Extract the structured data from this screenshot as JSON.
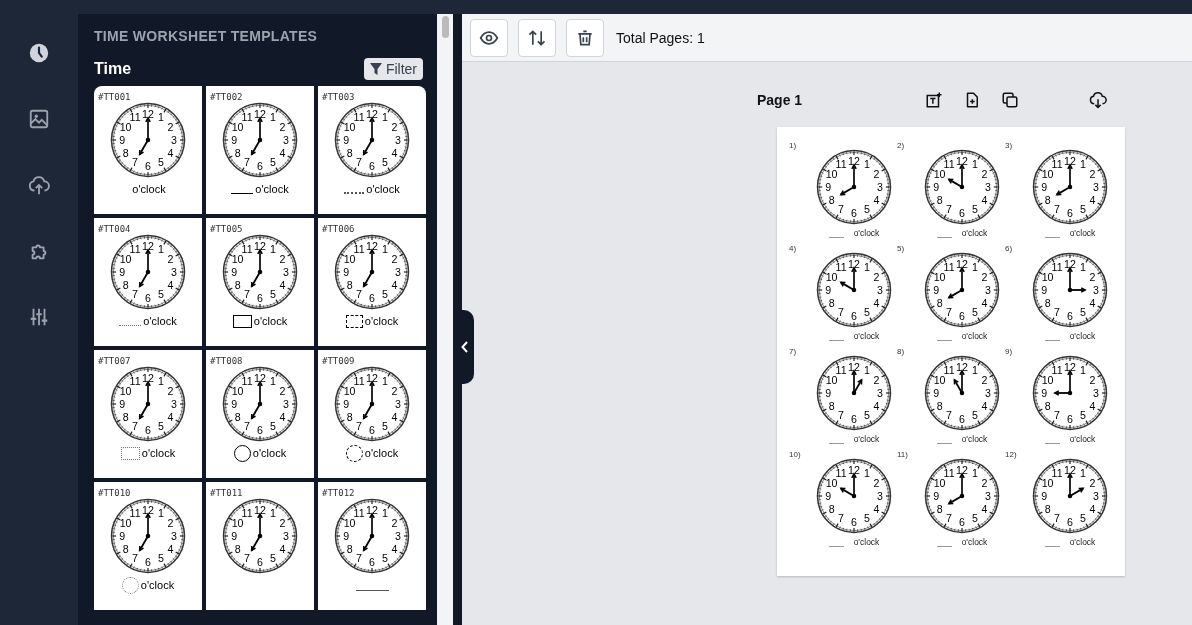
{
  "sidebar_icons": [
    {
      "kind": "clock"
    },
    {
      "kind": "image"
    },
    {
      "kind": "upload"
    },
    {
      "kind": "puzzle"
    },
    {
      "kind": "sliders"
    }
  ],
  "panel": {
    "heading": "TIME WORKSHEET TEMPLATES",
    "section": "Time",
    "filter_button": "Filter",
    "templates": [
      {
        "id": "#TT001",
        "kind": "blank",
        "dial": [
          "11",
          "12",
          "1",
          "10",
          "2",
          "9",
          "3",
          "8",
          "4",
          "7",
          "6",
          "5"
        ],
        "hour_hand": [
          false,
          false,
          false,
          false,
          false,
          false,
          false,
          false,
          false,
          true,
          false,
          false
        ],
        "label": "o'clock"
      },
      {
        "id": "#TT002",
        "kind": "line",
        "dial": [
          "11",
          "12",
          "1",
          "10",
          "2",
          "9",
          "3",
          "8",
          "4",
          "7",
          "6",
          "5"
        ],
        "hour_hand": [
          false,
          false,
          false,
          false,
          false,
          false,
          false,
          false,
          false,
          true,
          false,
          false
        ],
        "label": "o'clock"
      },
      {
        "id": "#TT003",
        "kind": "dots",
        "dial": [
          "11",
          "12",
          "1",
          "10",
          "2",
          "9",
          "3",
          "8",
          "4",
          "7",
          "6",
          "5"
        ],
        "hour_hand": [
          false,
          false,
          false,
          false,
          false,
          false,
          false,
          false,
          false,
          true,
          false,
          false
        ],
        "label": "o'clock"
      },
      {
        "id": "#TT004",
        "kind": "dotted-line",
        "dial": [
          "11",
          "12",
          "1",
          "10",
          "2",
          "9",
          "3",
          "8",
          "4",
          "7",
          "6",
          "5"
        ],
        "hour_hand": [
          false,
          false,
          false,
          false,
          false,
          false,
          false,
          false,
          false,
          true,
          false,
          false
        ],
        "label": "o'clock"
      },
      {
        "id": "#TT005",
        "kind": "box",
        "dial": [
          "11",
          "12",
          "1",
          "10",
          "2",
          "9",
          "3",
          "8",
          "4",
          "7",
          "6",
          "5"
        ],
        "hour_hand": [
          false,
          false,
          false,
          false,
          false,
          false,
          false,
          false,
          false,
          true,
          false,
          false
        ],
        "label": "o'clock"
      },
      {
        "id": "#TT006",
        "kind": "dashed-box",
        "dial": [
          "11",
          "12",
          "1",
          "10",
          "2",
          "9",
          "3",
          "8",
          "4",
          "7",
          "6",
          "5"
        ],
        "hour_hand": [
          false,
          false,
          false,
          false,
          false,
          false,
          false,
          false,
          false,
          true,
          false,
          false
        ],
        "label": "o'clock"
      },
      {
        "id": "#TT007",
        "kind": "dotted-box",
        "dial": [
          "11",
          "12",
          "1",
          "10",
          "2",
          "9",
          "3",
          "8",
          "4",
          "7",
          "6",
          "5"
        ],
        "hour_hand": [
          false,
          false,
          false,
          false,
          false,
          false,
          false,
          false,
          false,
          true,
          false,
          false
        ],
        "label": "o'clock"
      },
      {
        "id": "#TT008",
        "kind": "circle",
        "dial": [
          "11",
          "12",
          "1",
          "10",
          "2",
          "9",
          "3",
          "8",
          "4",
          "7",
          "6",
          "5"
        ],
        "hour_hand": [
          false,
          false,
          false,
          false,
          false,
          false,
          false,
          false,
          false,
          true,
          false,
          false
        ],
        "label": "o'clock"
      },
      {
        "id": "#TT009",
        "kind": "dashed-circle",
        "dial": [
          "11",
          "12",
          "1",
          "10",
          "2",
          "9",
          "3",
          "8",
          "4",
          "7",
          "6",
          "5"
        ],
        "hour_hand": [
          false,
          false,
          false,
          false,
          false,
          false,
          false,
          false,
          false,
          true,
          false,
          false
        ],
        "label": "o'clock"
      },
      {
        "id": "#TT010",
        "kind": "dotted-circle",
        "dial": [
          "11",
          "12",
          "1",
          "10",
          "2",
          "9",
          "3",
          "8",
          "4",
          "7",
          "6",
          "5"
        ],
        "hour_hand": [
          false,
          false,
          false,
          false,
          false,
          false,
          false,
          false,
          false,
          true,
          false,
          false
        ],
        "label": "o'clock"
      },
      {
        "id": "#TT011",
        "kind": "none",
        "dial": [
          "11",
          "12",
          "1",
          "10",
          "2",
          "9",
          "3",
          "8",
          "4",
          "7",
          "6",
          "5"
        ],
        "hour_hand": [
          false,
          false,
          false,
          false,
          false,
          false,
          false,
          false,
          false,
          true,
          false,
          false
        ]
      },
      {
        "id": "#TT012",
        "kind": "long-line",
        "dial": [
          "11",
          "12",
          "1",
          "10",
          "2",
          "9",
          "3",
          "8",
          "4",
          "7",
          "6",
          "5"
        ],
        "hour_hand": [
          false,
          false,
          false,
          false,
          false,
          false,
          false,
          false,
          false,
          true,
          false,
          false
        ]
      }
    ]
  },
  "toolbar": {
    "buttons": [
      {
        "kind": "view"
      },
      {
        "kind": "sort"
      },
      {
        "kind": "delete"
      }
    ],
    "total_pages": "Total Pages: 1"
  },
  "page": {
    "title": "Page 1",
    "actions": [
      {
        "kind": "add-text"
      },
      {
        "kind": "add-page"
      },
      {
        "kind": "duplicate"
      },
      {
        "kind": "download"
      }
    ],
    "questions": [
      {
        "number": "1)",
        "dial": [
          "11",
          "12",
          "1",
          "10",
          "2",
          "9",
          "3",
          "8",
          "4",
          "7",
          "6",
          "5"
        ],
        "hour_hand": [
          false,
          false,
          false,
          false,
          false,
          false,
          false,
          true,
          false,
          false,
          false,
          false
        ],
        "label": "o'clock"
      },
      {
        "number": "2)",
        "dial": [
          "11",
          "12",
          "1",
          "10",
          "2",
          "9",
          "3",
          "8",
          "4",
          "7",
          "6",
          "5"
        ],
        "hour_hand": [
          false,
          false,
          false,
          true,
          false,
          false,
          false,
          false,
          false,
          false,
          false,
          false
        ],
        "label": "o'clock"
      },
      {
        "number": "3)",
        "dial": [
          "11",
          "12",
          "1",
          "10",
          "2",
          "9",
          "3",
          "8",
          "4",
          "7",
          "6",
          "5"
        ],
        "hour_hand": [
          false,
          false,
          false,
          false,
          false,
          false,
          false,
          true,
          false,
          false,
          false,
          false
        ],
        "label": "o'clock"
      },
      {
        "number": "4)",
        "dial": [
          "11",
          "12",
          "1",
          "10",
          "2",
          "9",
          "3",
          "8",
          "4",
          "7",
          "6",
          "5"
        ],
        "hour_hand": [
          false,
          false,
          false,
          true,
          false,
          false,
          false,
          false,
          false,
          false,
          false,
          false
        ],
        "label": "o'clock"
      },
      {
        "number": "5)",
        "dial": [
          "11",
          "12",
          "1",
          "10",
          "2",
          "9",
          "3",
          "8",
          "4",
          "7",
          "6",
          "5"
        ],
        "hour_hand": [
          false,
          false,
          false,
          false,
          false,
          false,
          false,
          true,
          false,
          false,
          false,
          false
        ],
        "label": "o'clock"
      },
      {
        "number": "6)",
        "dial": [
          "11",
          "12",
          "1",
          "10",
          "2",
          "9",
          "3",
          "8",
          "4",
          "7",
          "6",
          "5"
        ],
        "hour_hand": [
          false,
          false,
          false,
          false,
          false,
          false,
          true,
          false,
          false,
          false,
          false,
          false
        ],
        "label": "o'clock"
      },
      {
        "number": "7)",
        "dial": [
          "11",
          "12",
          "1",
          "10",
          "2",
          "9",
          "3",
          "8",
          "4",
          "7",
          "6",
          "5"
        ],
        "hour_hand": [
          false,
          false,
          true,
          false,
          false,
          false,
          false,
          false,
          false,
          false,
          false,
          false
        ],
        "label": "o'clock"
      },
      {
        "number": "8)",
        "dial": [
          "11",
          "12",
          "1",
          "10",
          "2",
          "9",
          "3",
          "8",
          "4",
          "7",
          "6",
          "5"
        ],
        "hour_hand": [
          true,
          false,
          false,
          false,
          false,
          false,
          false,
          false,
          false,
          false,
          false,
          false
        ],
        "label": "o'clock"
      },
      {
        "number": "9)",
        "dial": [
          "11",
          "12",
          "1",
          "10",
          "2",
          "9",
          "3",
          "8",
          "4",
          "7",
          "6",
          "5"
        ],
        "hour_hand": [
          false,
          false,
          false,
          false,
          false,
          true,
          false,
          false,
          false,
          false,
          false,
          false
        ],
        "label": "o'clock"
      },
      {
        "number": "10)",
        "dial": [
          "11",
          "12",
          "1",
          "10",
          "2",
          "9",
          "3",
          "8",
          "4",
          "7",
          "6",
          "5"
        ],
        "hour_hand": [
          false,
          false,
          false,
          true,
          false,
          false,
          false,
          false,
          false,
          false,
          false,
          false
        ],
        "label": "o'clock"
      },
      {
        "number": "11)",
        "dial": [
          "11",
          "12",
          "1",
          "10",
          "2",
          "9",
          "3",
          "8",
          "4",
          "7",
          "6",
          "5"
        ],
        "hour_hand": [
          false,
          false,
          false,
          false,
          false,
          false,
          false,
          true,
          false,
          false,
          false,
          false
        ],
        "label": "o'clock"
      },
      {
        "number": "12)",
        "dial": [
          "11",
          "12",
          "1",
          "10",
          "2",
          "9",
          "3",
          "8",
          "4",
          "7",
          "6",
          "5"
        ],
        "hour_hand": [
          false,
          false,
          false,
          false,
          true,
          false,
          false,
          false,
          false,
          false,
          false,
          false
        ],
        "label": "o'clock"
      }
    ]
  }
}
